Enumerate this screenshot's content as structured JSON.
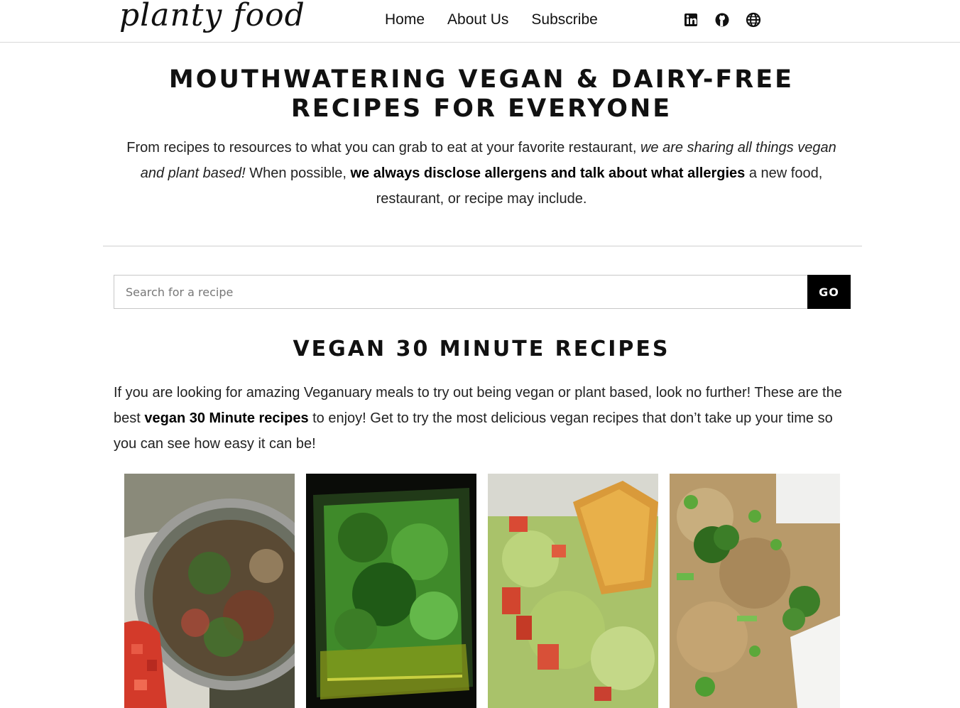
{
  "header": {
    "logo_text": "planty food",
    "nav": [
      "Home",
      "About Us",
      "Subscribe"
    ],
    "social_icons": [
      "linkedin-icon",
      "github-icon",
      "globe-icon"
    ]
  },
  "hero": {
    "title": "Mouthwatering Vegan & Dairy-free Recipes for Everyone",
    "text_part1": "From recipes to resources to what you can grab to eat at your favorite restaurant, ",
    "text_italic": "we are sharing all things vegan and plant based!",
    "text_part2": " When possible, ",
    "text_bold": "we always disclose allergens and talk about what allergies",
    "text_part3": " a new food, restaurant, or recipe may include."
  },
  "search": {
    "placeholder": "Search for a recipe",
    "value": "",
    "button_label": "GO"
  },
  "section": {
    "title": "VEGAN 30 MINUTE RECIPES",
    "text_part1": "If you are looking for amazing Veganuary meals to try out being vegan or plant based, look no further! These are the best ",
    "text_bold": "vegan 30 Minute recipes",
    "text_part2": " to enjoy! Get to try the most delicious vegan recipes that don’t take up your time so you can see how easy it can be!"
  },
  "recipe_cards": [
    {
      "image": "quinoa-tomato-salad-photo"
    },
    {
      "image": "herb-sauce-photo"
    },
    {
      "image": "guacamole-chip-photo"
    },
    {
      "image": "fried-rice-broccoli-photo"
    }
  ],
  "colors": {
    "text": "#111111",
    "divider": "#cfcfcf",
    "button_bg": "#000000",
    "button_text": "#ffffff"
  }
}
